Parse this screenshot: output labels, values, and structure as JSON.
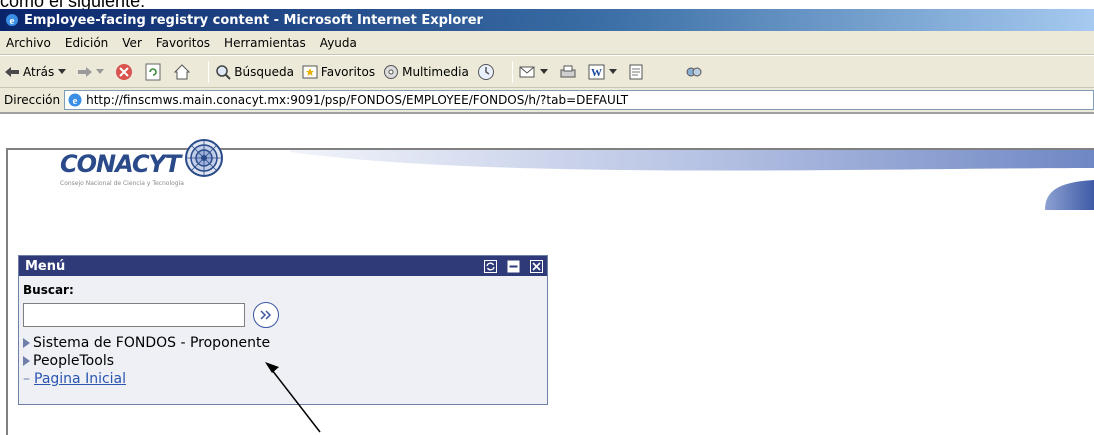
{
  "caption": "como el siguiente:",
  "window": {
    "title": "Employee-facing registry content - Microsoft Internet Explorer"
  },
  "menu": [
    "Archivo",
    "Edición",
    "Ver",
    "Favoritos",
    "Herramientas",
    "Ayuda"
  ],
  "toolbar": {
    "back": "Atrás",
    "search": "Búsqueda",
    "favorites": "Favoritos",
    "media": "Multimedia"
  },
  "address": {
    "label": "Dirección",
    "url": "http://finscmws.main.conacyt.mx:9091/psp/FONDOS/EMPLOYEE/FONDOS/h/?tab=DEFAULT"
  },
  "logo": {
    "name": "CONACYT",
    "subtitle": "Consejo Nacional de Ciencia y Tecnología"
  },
  "portlet": {
    "title": "Menú",
    "search_label": "Buscar:",
    "search_value": "",
    "items": [
      {
        "label": "Sistema de FONDOS - Proponente"
      },
      {
        "label": "PeopleTools"
      },
      {
        "label": "Pagina Inicial"
      }
    ]
  },
  "colors": {
    "titlebar": "#0a246a",
    "portlet_header": "#2f3b79",
    "link": "#2a56b0"
  }
}
